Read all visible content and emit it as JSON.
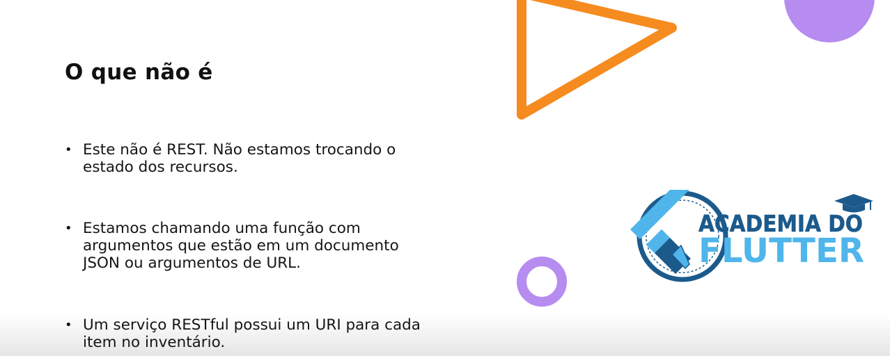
{
  "slide": {
    "title": "O que não é",
    "bullets": [
      {
        "symbol": "•",
        "lines": [
          "Este não é REST. Não estamos trocando o",
          "estado dos recursos."
        ]
      },
      {
        "symbol": "•",
        "lines": [
          "Estamos chamando uma função com",
          "argumentos que estão em um documento",
          "JSON ou argumentos de URL."
        ]
      },
      {
        "symbol": "•",
        "lines": [
          "Um serviço RESTful possui um URI para cada",
          "item no inventário."
        ]
      }
    ]
  },
  "logo": {
    "line1": "ACADEMIA DO",
    "line2": "FLUTTER",
    "icon": "graduation-cap-icon"
  },
  "colors": {
    "orange": "#f68b1f",
    "purple": "#b68cf0",
    "logo_dark_blue": "#1c5a8c",
    "logo_light_blue": "#4fb5ea"
  }
}
